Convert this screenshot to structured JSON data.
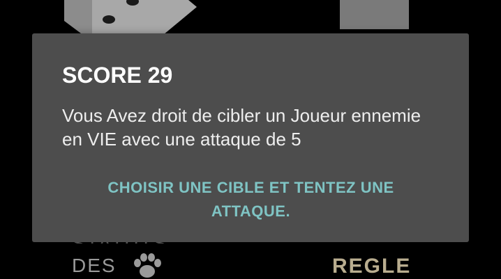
{
  "background": {
    "label_statuts": "STATUTS",
    "label_des": "DES",
    "label_regle": "REGLE",
    "icons": [
      "dice-icon",
      "paw-icon"
    ]
  },
  "dialog": {
    "title": "SCORE 29",
    "message": "Vous Avez droit de cibler un Joueur ennemie en VIE avec une attaque de 5",
    "action_label": "CHOISIR UNE CIBLE ET TENTEZ UNE ATTAQUE."
  },
  "colors": {
    "screen_background": "#000000",
    "dialog_background": "#4d4d4d",
    "dialog_title": "#ffffff",
    "action_text": "#7fc4c4",
    "regle_text": "#b9ad8f"
  }
}
